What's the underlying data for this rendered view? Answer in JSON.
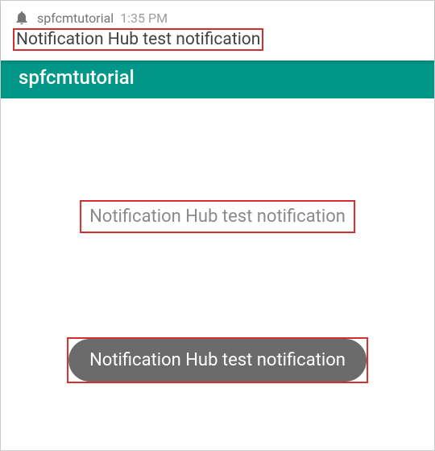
{
  "notification": {
    "app_name": "spfcmtutorial",
    "time": "1:35 PM",
    "title": "Notification Hub test notification"
  },
  "appbar": {
    "title": "spfcmtutorial"
  },
  "dialog": {
    "message": "Notification Hub test notification"
  },
  "toast": {
    "message": "Notification Hub test notification"
  }
}
